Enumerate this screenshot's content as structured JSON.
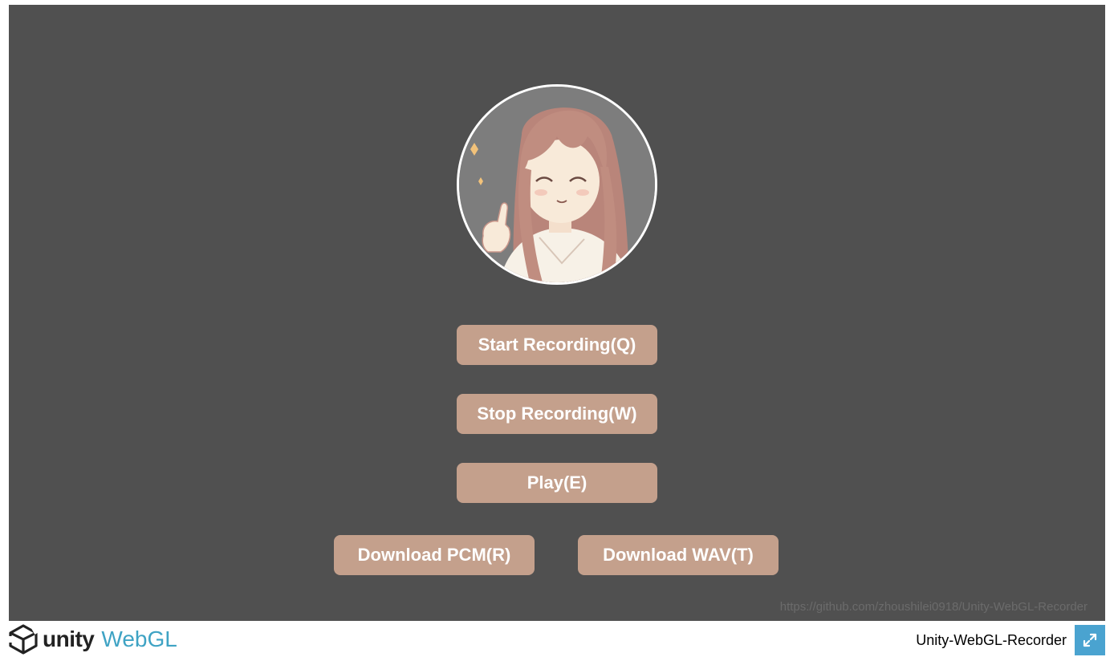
{
  "app": {
    "page_title": "Unity-WebGL-Recorder"
  },
  "canvas": {
    "background": "#505050",
    "avatar_icon": "anime-girl-thumbs-up",
    "buttons": {
      "start_recording": "Start Recording(Q)",
      "stop_recording": "Stop Recording(W)",
      "play": "Play(E)",
      "download_pcm": "Download PCM(R)",
      "download_wav": "Download WAV(T)"
    },
    "button_color": "#c4a08c",
    "repo_link": "https://github.com/zhoushilei0918/Unity-WebGL-Recorder"
  },
  "footer": {
    "logo_unity": "unity",
    "logo_webgl": "WebGL",
    "title": "Unity-WebGL-Recorder",
    "fullscreen_icon": "expand-arrows-icon",
    "accent_color": "#4aa3d0"
  }
}
